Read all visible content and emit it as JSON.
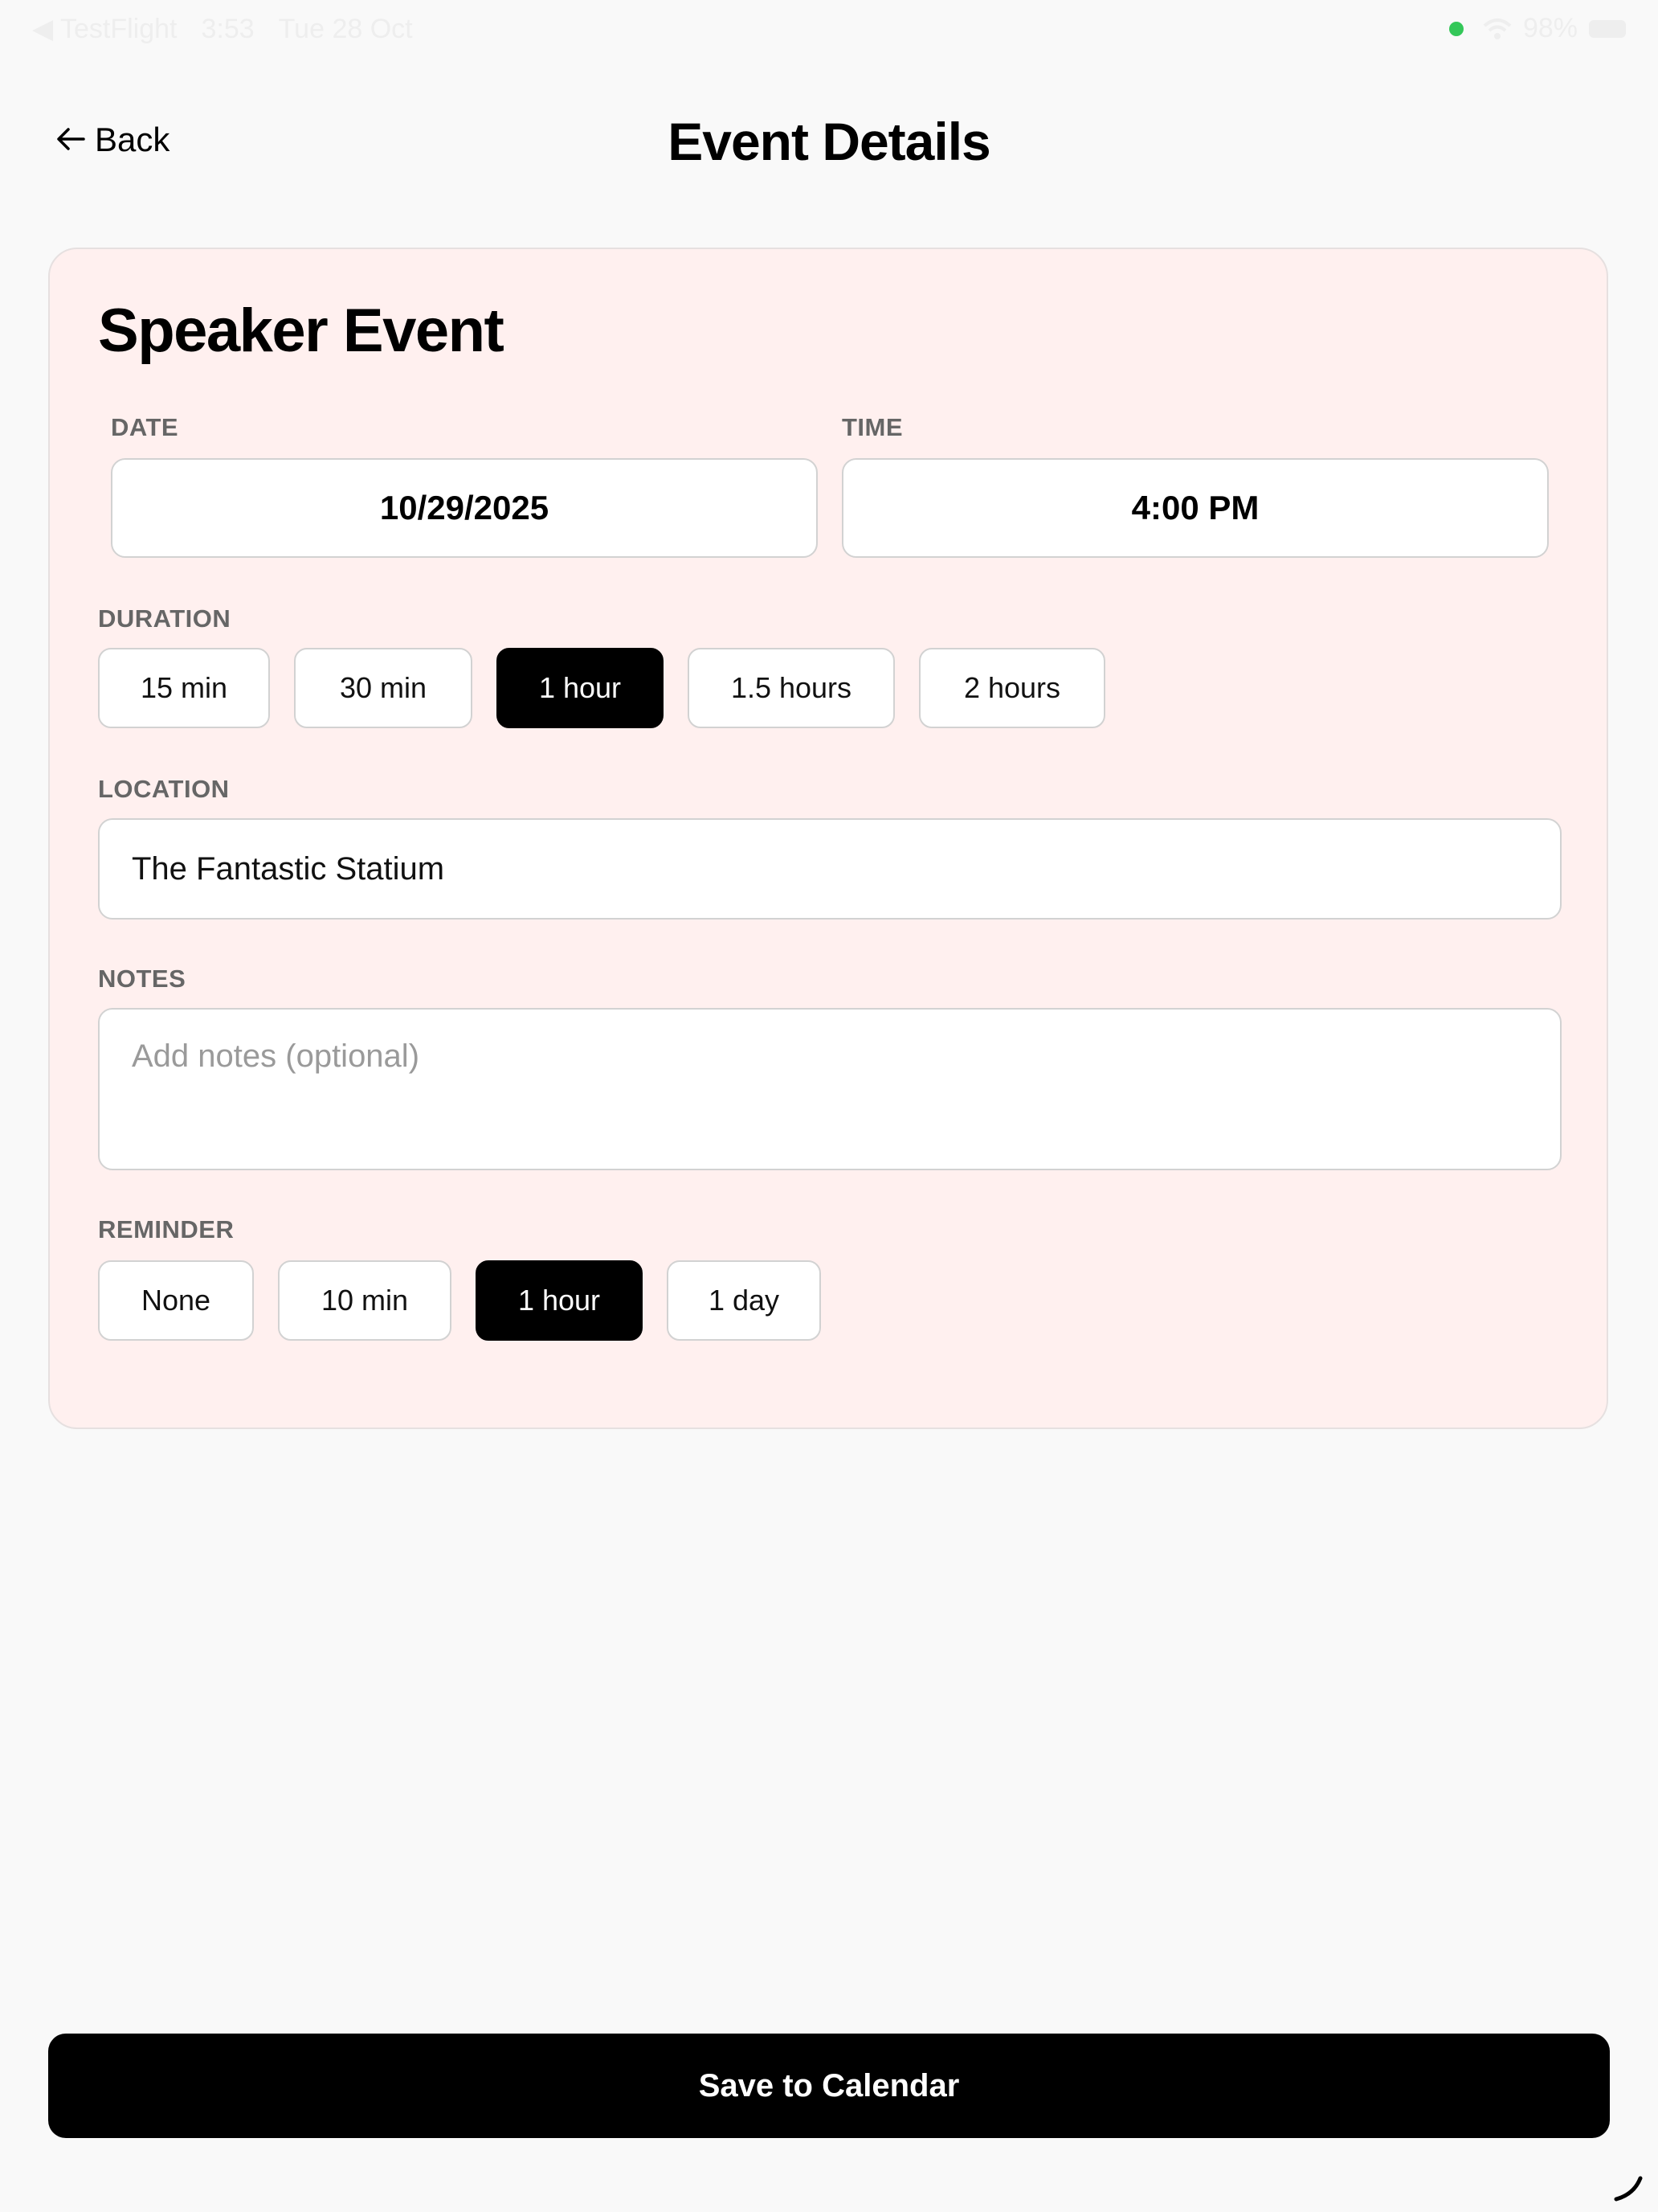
{
  "status_bar": {
    "back_app": "◀ TestFlight",
    "time": "3:53",
    "date": "Tue 28 Oct",
    "battery": "98%"
  },
  "header": {
    "back_label": "Back",
    "title": "Event Details"
  },
  "event": {
    "title": "Speaker Event",
    "date_label": "DATE",
    "date_value": "10/29/2025",
    "time_label": "TIME",
    "time_value": "4:00 PM",
    "duration_label": "DURATION",
    "duration_options": [
      "15 min",
      "30 min",
      "1 hour",
      "1.5 hours",
      "2 hours"
    ],
    "duration_selected": "1 hour",
    "location_label": "LOCATION",
    "location_value": "The Fantastic Statium",
    "notes_label": "NOTES",
    "notes_value": "",
    "notes_placeholder": "Add notes (optional)",
    "reminder_label": "REMINDER",
    "reminder_options": [
      "None",
      "10 min",
      "1 hour",
      "1 day"
    ],
    "reminder_selected": "1 hour"
  },
  "footer": {
    "save_label": "Save to Calendar"
  },
  "colors": {
    "background": "#f9f9f9",
    "card_background": "#fff0ef",
    "selected_chip": "#000000",
    "status_dot": "#34c759"
  }
}
